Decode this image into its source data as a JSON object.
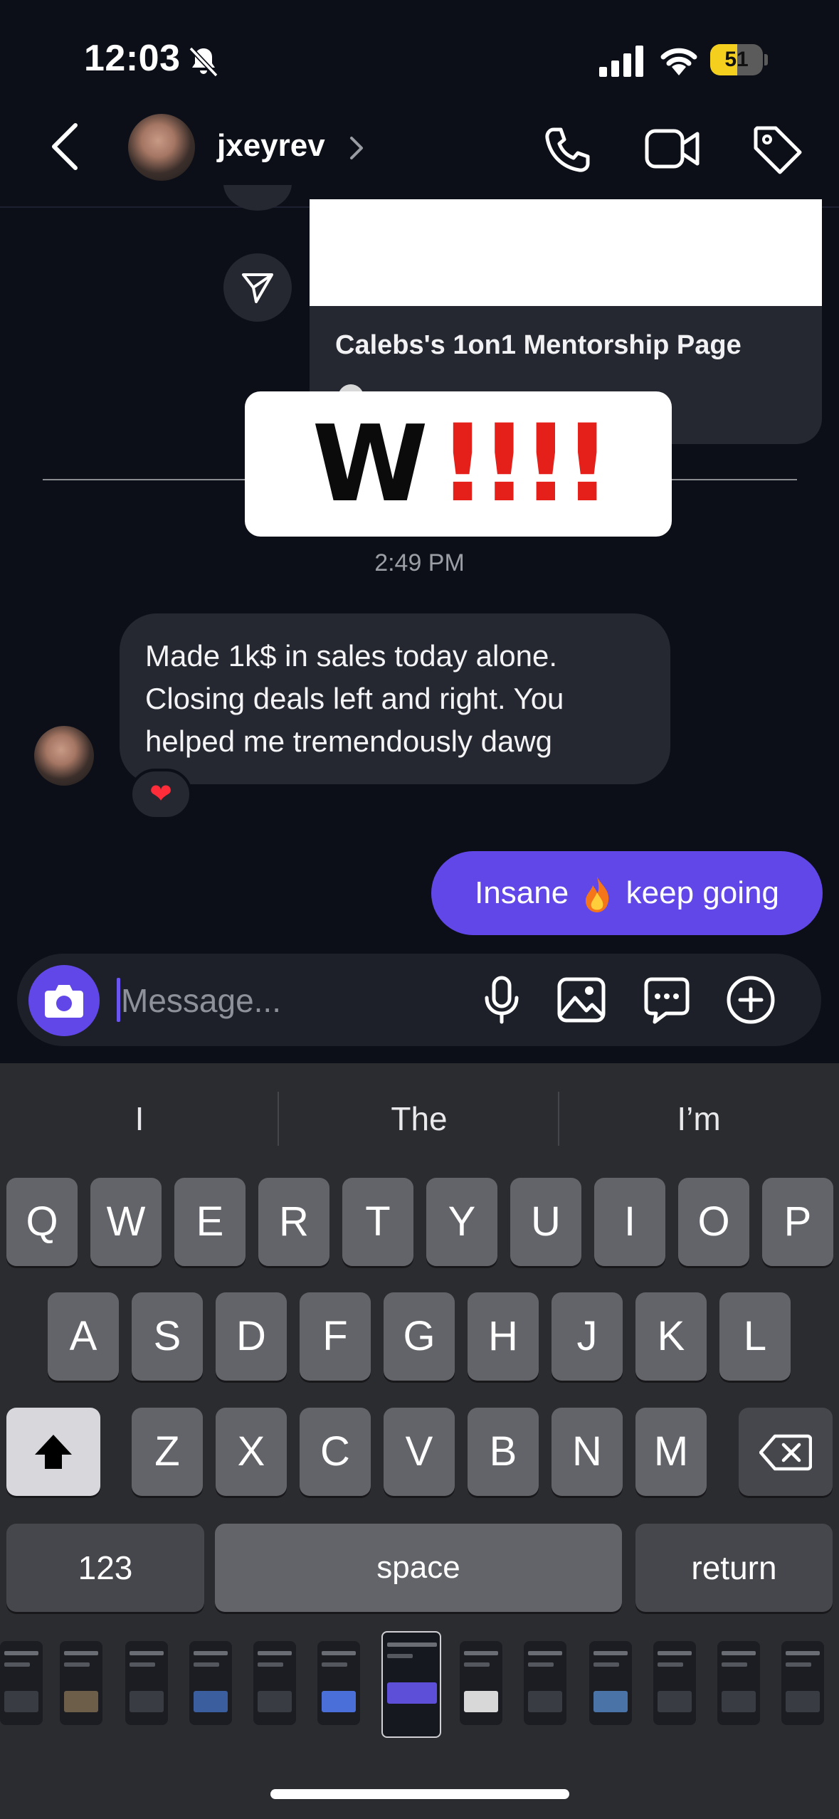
{
  "status_bar": {
    "time": "12:03",
    "battery": "51",
    "battery_fraction": 0.51
  },
  "header": {
    "username": "jxeyrev",
    "icons": [
      "back-chevron-icon",
      "phone-icon",
      "video-icon",
      "tag-icon"
    ]
  },
  "shared_post": {
    "title": "Calebs's 1on1 Mentorship Page"
  },
  "sticker": {
    "letter": "W",
    "exclaims": "!!!!"
  },
  "timestamp": "2:49 PM",
  "incoming_message": {
    "text": "Made 1k$ in sales today alone. Closing deals left and right. You helped me tremendously dawg",
    "reaction": "❤"
  },
  "outgoing_message": {
    "before": "Insane",
    "after": "keep going"
  },
  "composer": {
    "placeholder": "Message..."
  },
  "keyboard": {
    "suggestions": [
      "I",
      "The",
      "I’m"
    ],
    "row1": [
      "Q",
      "W",
      "E",
      "R",
      "T",
      "Y",
      "U",
      "I",
      "O",
      "P"
    ],
    "row2": [
      "A",
      "S",
      "D",
      "F",
      "G",
      "H",
      "J",
      "K",
      "L"
    ],
    "row3": [
      "Z",
      "X",
      "C",
      "V",
      "B",
      "N",
      "M"
    ],
    "numbers_label": "123",
    "space_label": "space",
    "return_label": "return"
  },
  "colors": {
    "background": "#0c0f17",
    "bubble_incoming": "#252830",
    "bubble_outgoing": "#6147e8",
    "accent": "#6147e8"
  }
}
